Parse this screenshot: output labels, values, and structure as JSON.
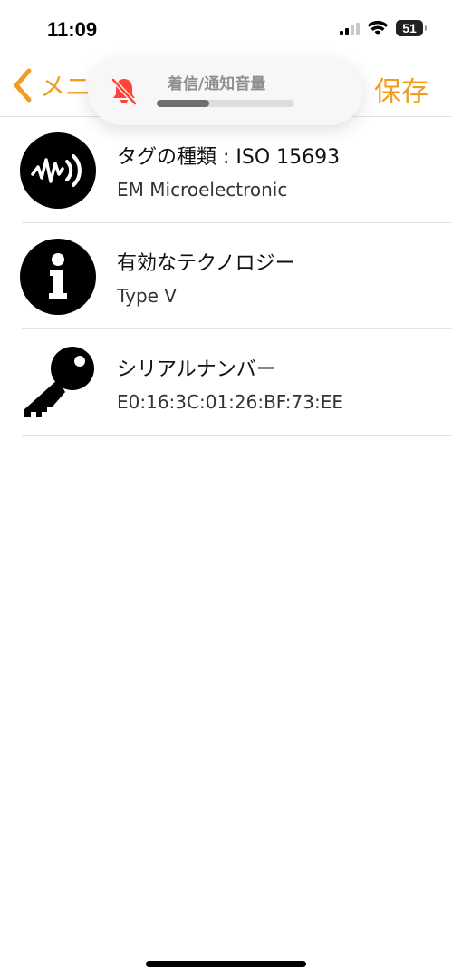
{
  "status_bar": {
    "time": "11:09",
    "battery": "51",
    "signal_icon": "cellular-signal-icon",
    "wifi_icon": "wifi-icon"
  },
  "nav": {
    "back_label": "メニ",
    "save_label": "保存",
    "accent_color": "#f39c22"
  },
  "volume_hud": {
    "title": "着信/通知音量",
    "level": 0.38,
    "icon": "bell-muted-icon"
  },
  "rows": [
    {
      "title": "タグの種類 : ISO 15693",
      "subtitle": "EM Microelectronic",
      "icon": "nfc-wave-icon"
    },
    {
      "title": "有効なテクノロジー",
      "subtitle": "Type V",
      "icon": "info-icon"
    },
    {
      "title": "シリアルナンバー",
      "subtitle": "E0:16:3C:01:26:BF:73:EE",
      "icon": "key-icon"
    }
  ]
}
